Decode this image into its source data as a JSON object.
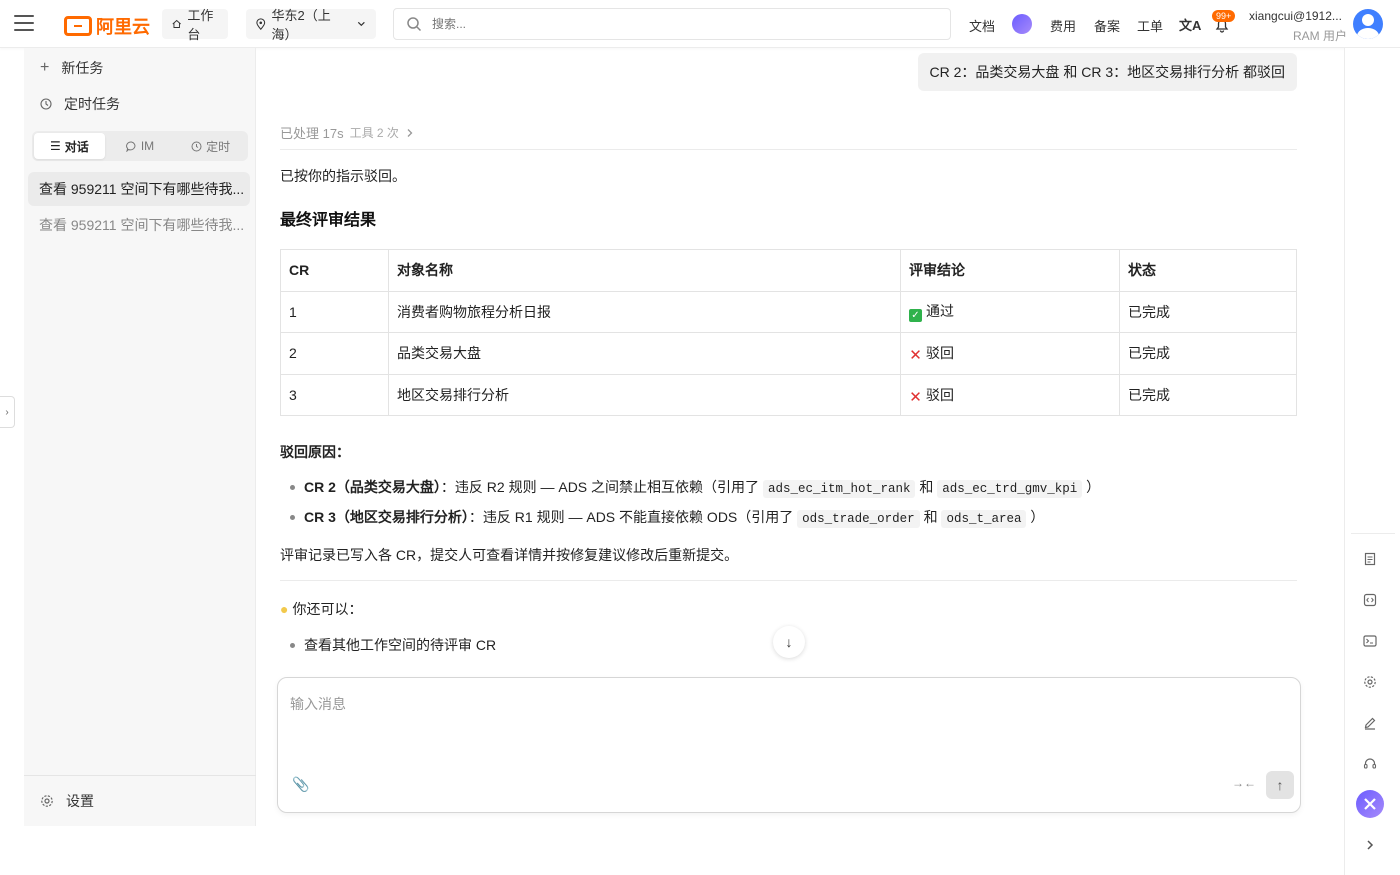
{
  "header": {
    "logo_text": "阿里云",
    "workbench": "工作台",
    "region": "华东2（上海）",
    "search_placeholder": "搜索...",
    "links": [
      "文档",
      "费用",
      "备案",
      "工单"
    ],
    "notification_badge": "99+",
    "user_name": "xiangcui@1912...",
    "user_role": "RAM 用户"
  },
  "sidebar": {
    "new_task": "新任务",
    "scheduled_task": "定时任务",
    "tabs": [
      {
        "label": "对话",
        "icon": "list-icon",
        "active": true
      },
      {
        "label": "IM",
        "icon": "chat-bubble-icon",
        "active": false
      },
      {
        "label": "定时",
        "icon": "clock-icon",
        "active": false
      }
    ],
    "conversations": [
      {
        "title": "查看 959211 空间下有哪些待我...",
        "active": true
      },
      {
        "title": "查看 959211 空间下有哪些待我...",
        "active": false
      }
    ],
    "settings": "设置"
  },
  "chat": {
    "user_message": "CR 2：品类交易大盘 和 CR 3：地区交易排行分析 都驳回",
    "processed_label": "已处理 17s",
    "tools_label": "工具 2 次",
    "ack": "已按你的指示驳回。",
    "result_heading": "最终评审结果",
    "table": {
      "headers": [
        "CR",
        "对象名称",
        "评审结论",
        "状态"
      ],
      "rows": [
        {
          "cr": "1",
          "name": "消费者购物旅程分析日报",
          "verdict": "通过",
          "verdict_type": "pass",
          "status": "已完成"
        },
        {
          "cr": "2",
          "name": "品类交易大盘",
          "verdict": "驳回",
          "verdict_type": "reject",
          "status": "已完成"
        },
        {
          "cr": "3",
          "name": "地区交易排行分析",
          "verdict": "驳回",
          "verdict_type": "reject",
          "status": "已完成"
        }
      ]
    },
    "reject_title": "驳回原因：",
    "reasons": [
      {
        "bold": "CR 2（品类交易大盘）",
        "text": "：违反 R2 规则 — ADS 之间禁止相互依赖（引用了",
        "code1": "ads_ec_itm_hot_rank",
        "and": "和",
        "code2": "ads_ec_trd_gmv_kpi",
        "end": "）"
      },
      {
        "bold": "CR 3（地区交易排行分析）",
        "text": "：违反 R1 规则 — ADS 不能直接依赖 ODS（引用了",
        "code1": "ods_trade_order",
        "and": "和",
        "code2": "ods_t_area",
        "end": "）"
      }
    ],
    "record_note": "评审记录已写入各 CR，提交人可查看详情并按修复建议修改后重新提交。",
    "suggest_title": "你还可以：",
    "suggestions": [
      "查看其他工作空间的待评审 CR"
    ]
  },
  "composer": {
    "placeholder": "输入消息"
  }
}
